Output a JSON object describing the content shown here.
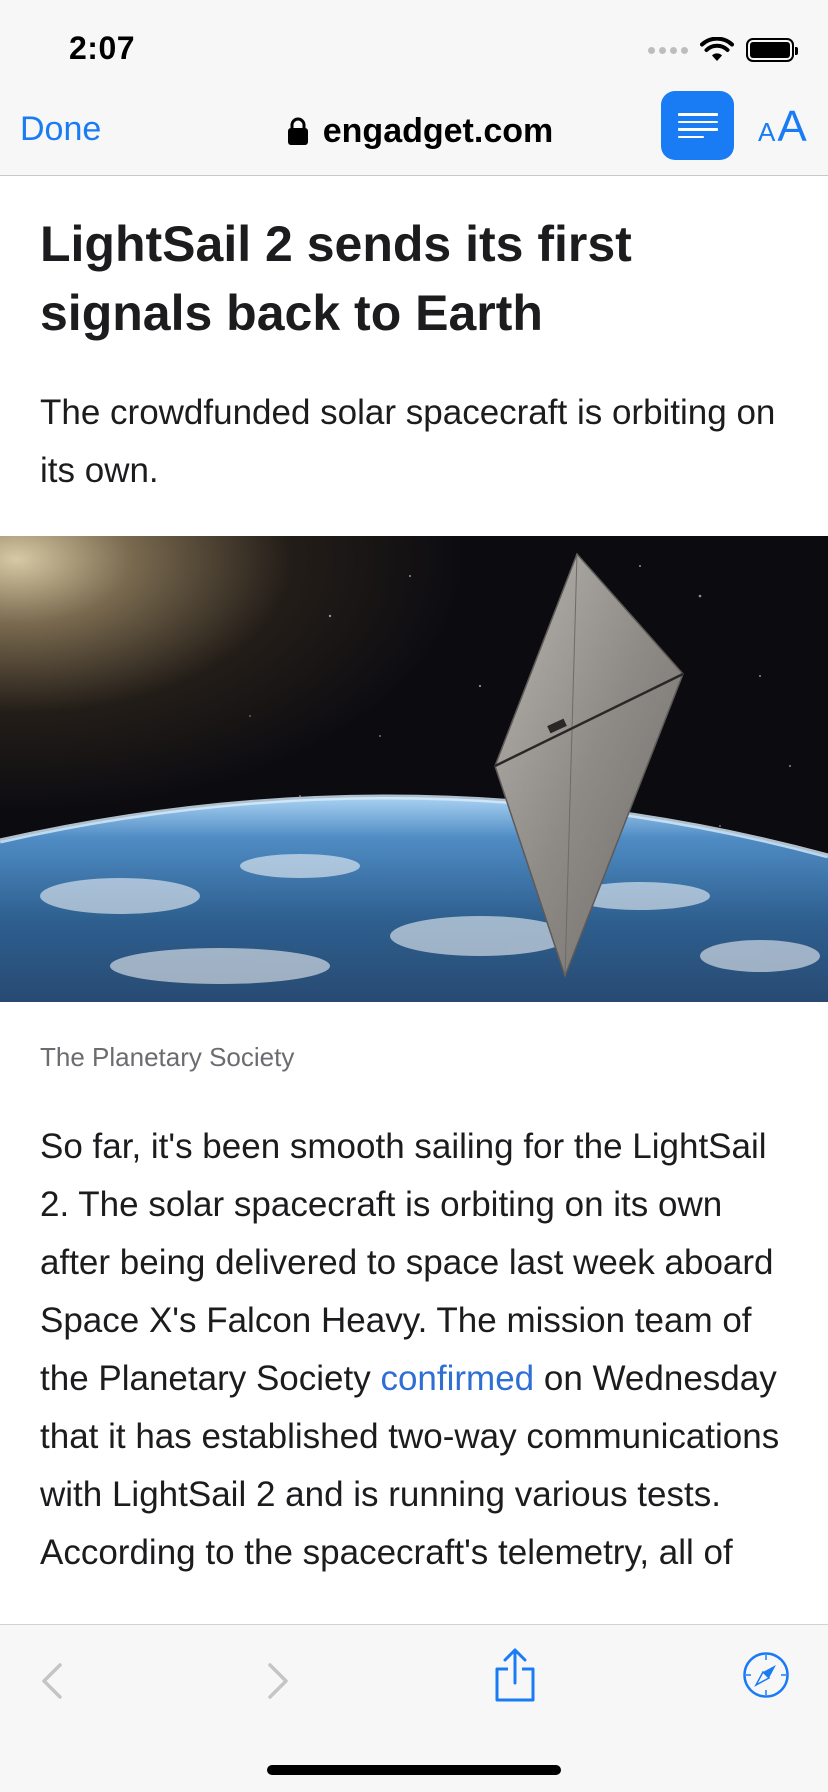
{
  "status_bar": {
    "time": "2:07",
    "icons": [
      "signal-dots-icon",
      "wifi-icon",
      "battery-icon"
    ]
  },
  "nav": {
    "done_label": "Done",
    "url": "engadget.com",
    "lock_icon": "lock-icon",
    "reader_icon": "reader-view-icon",
    "text_size_small": "A",
    "text_size_big": "A"
  },
  "article": {
    "title": "LightSail 2 sends its first signals back to Earth",
    "subtitle": "The crowdfunded solar spacecraft is orbiting on its own.",
    "image_caption": "The Planetary Society",
    "body_before_link": "So far, it's been smooth sailing for the LightSail 2. The solar spacecraft is orbiting on its own after being delivered to space last week aboard Space X's Falcon Heavy. The mission team of the Planetary Society ",
    "link_text": "confirmed",
    "body_after_link": " on Wednesday that it has established two-way communications with LightSail 2 and is running various tests. According to the spacecraft's telemetry, all of"
  },
  "toolbar": {
    "icons": [
      "back-chevron-icon",
      "forward-chevron-icon",
      "share-icon",
      "compass-icon"
    ]
  },
  "colors": {
    "accent": "#1a7cf5",
    "link": "#2f6fd4",
    "bar_background": "#f7f7f8",
    "text": "#1c1c1e",
    "caption": "#6c6c70"
  }
}
